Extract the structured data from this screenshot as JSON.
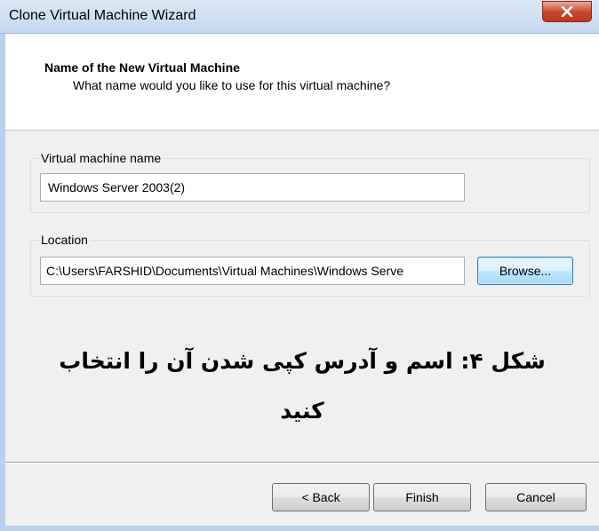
{
  "window": {
    "title": "Clone Virtual Machine Wizard",
    "close_icon": "close-icon"
  },
  "header": {
    "title": "Name of the New Virtual Machine",
    "subtitle": "What name would you like to use for this virtual machine?"
  },
  "vm_name": {
    "group_label": "Virtual machine name",
    "value": "Windows Server 2003(2)"
  },
  "location": {
    "group_label": "Location",
    "value": "C:\\Users\\FARSHID\\Documents\\Virtual Machines\\Windows Serve",
    "browse_label": "Browse..."
  },
  "caption": {
    "line1": "شکل ۴: اسم و آدرس کپی شدن آن را انتخاب",
    "line2": "کنید"
  },
  "footer": {
    "back_label": "< Back",
    "finish_label": "Finish",
    "cancel_label": "Cancel"
  },
  "colors": {
    "title_bar": "#c4d8ee",
    "close_button": "#c8432b",
    "dialog_bg": "#f0f0f0"
  }
}
